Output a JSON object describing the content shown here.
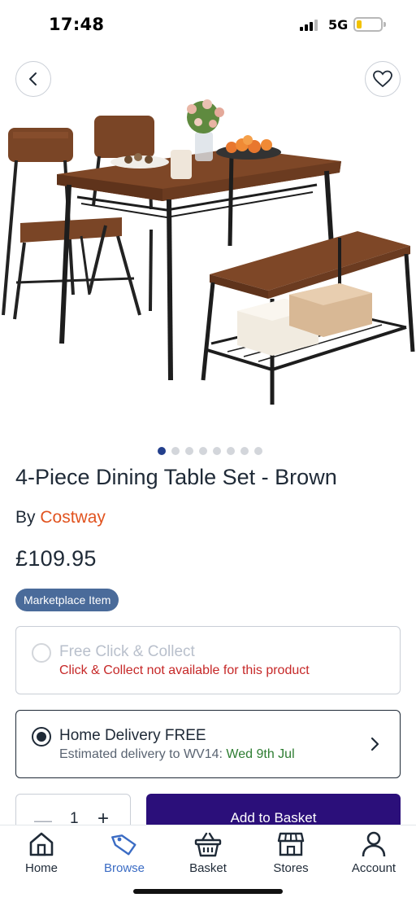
{
  "status_bar": {
    "time": "17:48",
    "network": "5G",
    "battery_level": 0.2
  },
  "gallery": {
    "image_count": 8,
    "active_index": 0
  },
  "product": {
    "title": "4-Piece Dining Table Set - Brown",
    "by_prefix": "By",
    "brand": "Costway",
    "price": "£109.95",
    "badge": "Marketplace Item"
  },
  "fulfilment": {
    "click_collect": {
      "title": "Free Click & Collect",
      "subtitle": "Click & Collect not available for this product",
      "selected": false
    },
    "home_delivery": {
      "title": "Home Delivery FREE",
      "subtitle_prefix": "Estimated delivery to WV14:",
      "date": "Wed 9th Jul",
      "selected": true
    }
  },
  "purchase": {
    "quantity": "1",
    "minus": "—",
    "plus": "+",
    "add_label": "Add to Basket"
  },
  "nav": {
    "items": [
      {
        "label": "Home",
        "icon": "home-icon"
      },
      {
        "label": "Browse",
        "icon": "tag-icon",
        "active": true
      },
      {
        "label": "Basket",
        "icon": "basket-icon"
      },
      {
        "label": "Stores",
        "icon": "store-icon"
      },
      {
        "label": "Account",
        "icon": "account-icon"
      }
    ]
  },
  "colors": {
    "brand": "#e1531f",
    "primary_button": "#2b0f7a",
    "badge": "#4a6b9a",
    "active_nav": "#3b6cc4",
    "delivery_date": "#2e7d32",
    "error": "#c62828"
  }
}
